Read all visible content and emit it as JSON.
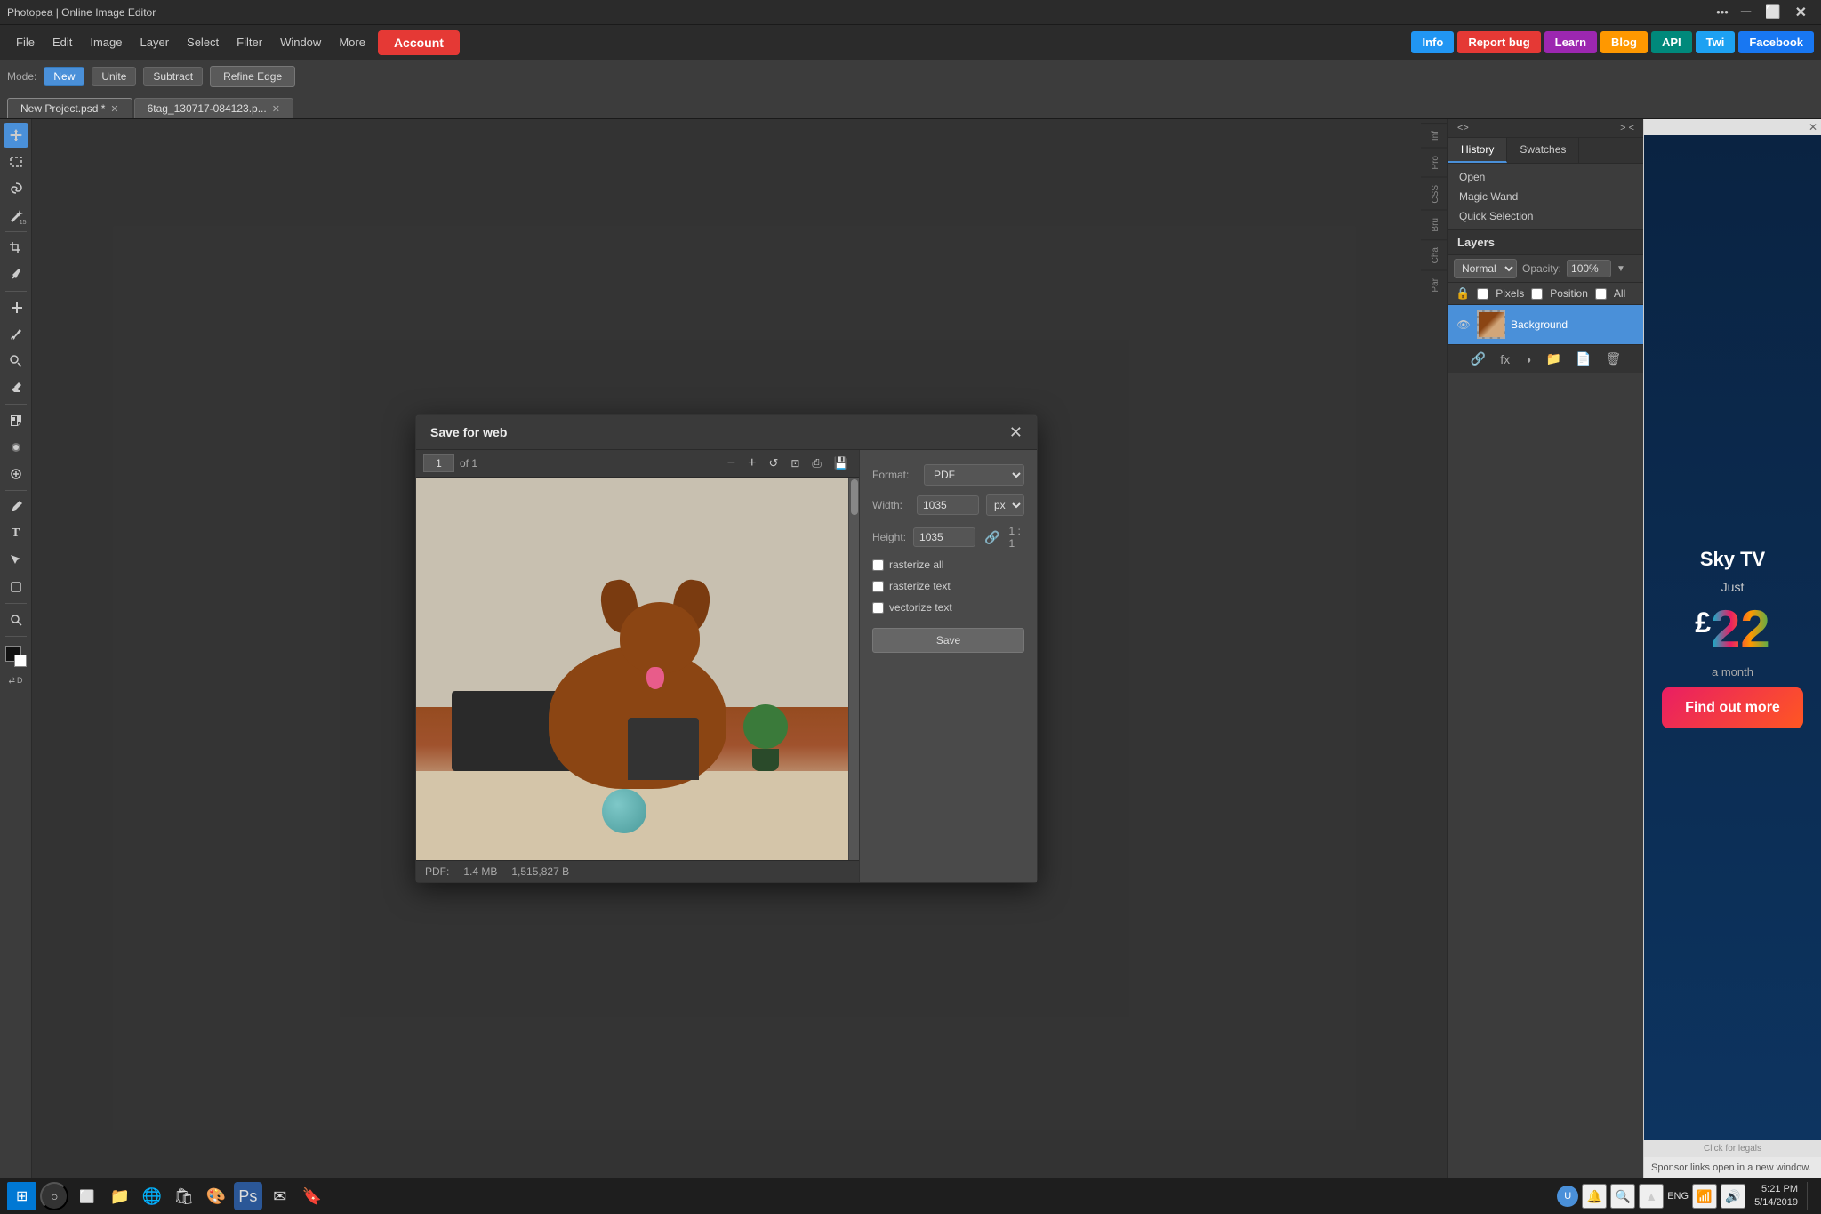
{
  "app": {
    "title": "Photopea | Online Image Editor",
    "window_controls": [
      "minimize",
      "maximize",
      "close"
    ]
  },
  "menubar": {
    "items": [
      "File",
      "Edit",
      "Image",
      "Layer",
      "Select",
      "Filter",
      "Window",
      "More"
    ],
    "account_label": "Account",
    "top_buttons": [
      {
        "label": "Info",
        "id": "info",
        "color": "#2196f3"
      },
      {
        "label": "Report bug",
        "id": "reportbug",
        "color": "#e53935"
      },
      {
        "label": "Learn",
        "id": "learn",
        "color": "#9c27b0"
      },
      {
        "label": "Blog",
        "id": "blog",
        "color": "#ff9800"
      },
      {
        "label": "API",
        "id": "api",
        "color": "#00897b"
      },
      {
        "label": "Twi",
        "id": "twi",
        "color": "#1da1f2"
      },
      {
        "label": "Facebook",
        "id": "facebook",
        "color": "#1877f2"
      }
    ]
  },
  "toolbar": {
    "mode_label": "Mode:",
    "mode_new": "New",
    "mode_unite": "Unite",
    "mode_subtract": "Subtract",
    "refine_edge": "Refine Edge"
  },
  "tabs": [
    {
      "label": "New Project.psd",
      "active": true,
      "closable": true
    },
    {
      "label": "6tag_130717-084123.p...",
      "active": false,
      "closable": true
    }
  ],
  "history_panel": {
    "title": "History",
    "swatches_tab": "Swatches",
    "items": [
      "Open",
      "Magic Wand",
      "Quick Selection"
    ]
  },
  "layers_panel": {
    "title": "Layers",
    "blend_mode": "Normal",
    "opacity_label": "Opacity:",
    "opacity_value": "100%",
    "lock_label": "Lock:",
    "checkboxes": [
      "Pixels",
      "Position",
      "All"
    ],
    "items": [
      {
        "name": "Background",
        "visible": true
      }
    ]
  },
  "dialog": {
    "title": "Save for web",
    "page_number": "1",
    "page_total": "of 1",
    "format_label": "Format:",
    "format_value": "PDF",
    "width_label": "Width:",
    "width_value": "1035",
    "height_label": "Height:",
    "height_value": "1035",
    "ratio": "1 : 1",
    "unit": "px",
    "checkboxes": [
      {
        "label": "rasterize all",
        "checked": false
      },
      {
        "label": "rasterize text",
        "checked": false
      },
      {
        "label": "vectorize text",
        "checked": false
      }
    ],
    "save_button": "Save",
    "footer": {
      "format_label": "PDF:",
      "size_mb": "1.4 MB",
      "size_bytes": "1,515,827 B"
    }
  },
  "ad": {
    "brand": "Sky TV",
    "tagline_just": "Just",
    "price_symbol": "£",
    "price": "22",
    "period": "a month",
    "cta": "Find out more",
    "footer": "Click for legals",
    "sponsor_note": "Sponsor links open in a new window."
  },
  "statusbar": {
    "time": "5:21 PM",
    "date": "5/14/2019",
    "lang": "ENG"
  },
  "tools": [
    {
      "name": "move",
      "icon": "✥",
      "badge": ""
    },
    {
      "name": "select-rect",
      "icon": "▭",
      "badge": ""
    },
    {
      "name": "lasso",
      "icon": "⬡",
      "badge": ""
    },
    {
      "name": "magic-wand",
      "icon": "✳",
      "badge": "15"
    },
    {
      "name": "crop",
      "icon": "⊡",
      "badge": ""
    },
    {
      "name": "eyedropper",
      "icon": "⊿",
      "badge": ""
    },
    {
      "name": "heal",
      "icon": "✚",
      "badge": ""
    },
    {
      "name": "brush",
      "icon": "✏",
      "badge": ""
    },
    {
      "name": "clone",
      "icon": "⬡",
      "badge": ""
    },
    {
      "name": "eraser",
      "icon": "◻",
      "badge": ""
    },
    {
      "name": "fill",
      "icon": "◈",
      "badge": ""
    },
    {
      "name": "blur",
      "icon": "◉",
      "badge": ""
    },
    {
      "name": "dodge",
      "icon": "○",
      "badge": ""
    },
    {
      "name": "pen",
      "icon": "✑",
      "badge": ""
    },
    {
      "name": "text",
      "icon": "T",
      "badge": ""
    },
    {
      "name": "path-select",
      "icon": "▷",
      "badge": ""
    },
    {
      "name": "shape",
      "icon": "◆",
      "badge": ""
    },
    {
      "name": "zoom",
      "icon": "⊕",
      "badge": ""
    }
  ]
}
